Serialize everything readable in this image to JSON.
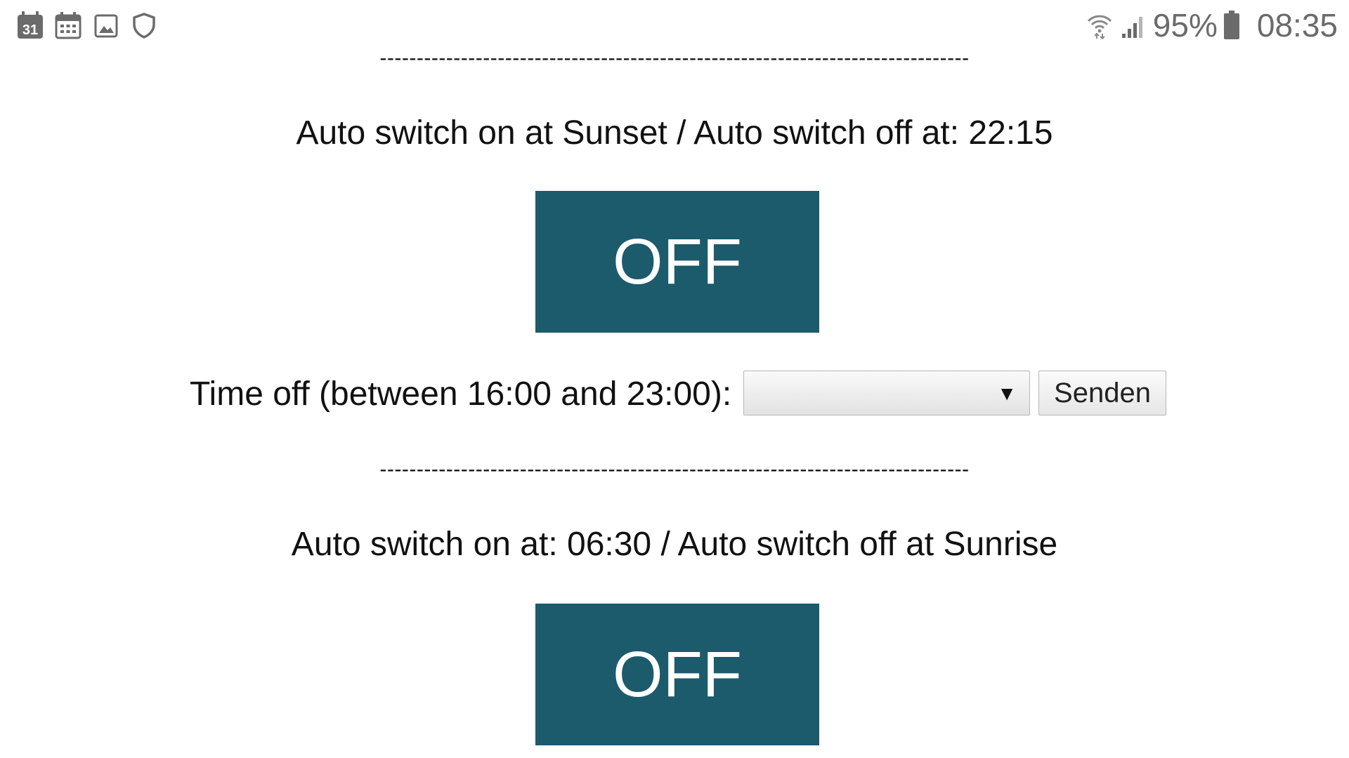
{
  "status_bar": {
    "calendar_day": "31",
    "battery_percent": "95%",
    "time": "08:35",
    "left_icons": [
      "calendar-day-icon",
      "calendar-grid-icon",
      "gallery-icon",
      "shield-icon"
    ],
    "right_icons": [
      "wifi-icon",
      "signal-icon",
      "battery-icon"
    ],
    "icon_color": "#6b6b6b"
  },
  "content": {
    "divider_text": "--------------------------------------------------------------------------------",
    "section1": {
      "caption": "Auto switch on at Sunset / Auto switch off at: 22:15",
      "button_label": "OFF"
    },
    "time_off": {
      "label": "Time off (between 16:00 and 23:00):",
      "selected_value": "",
      "submit_label": "Senden"
    },
    "section2": {
      "caption": "Auto switch on at: 06:30 / Auto switch off at Sunrise",
      "button_label": "OFF"
    },
    "button_color": "#1c5b6b"
  }
}
